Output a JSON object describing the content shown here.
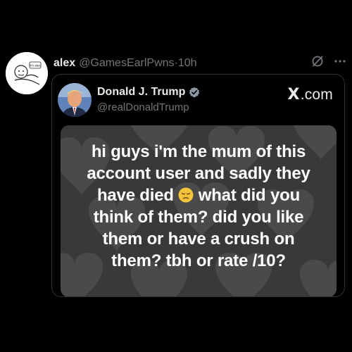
{
  "tweet": {
    "author_name": "alex",
    "author_handle": "@GamesEarlPwns",
    "separator": "·",
    "time": "10h",
    "avatar_text": "i'm alex"
  },
  "quote": {
    "author_name": "Donald J. Trump",
    "author_handle": "@realDonaldTrump",
    "verified_color": "#8b98a5",
    "source_label": ".com",
    "source_mark": "X",
    "text_lines": [
      "hi guys i'm the mum of this",
      "account user and sadly they",
      "have died",
      "what did you",
      "think of them? did you like",
      "them or have a crush on",
      "them? tbh or rate /10?"
    ],
    "emoji": "disappointed-face"
  },
  "icons": {
    "grok": "grok-icon",
    "more": "more-icon",
    "verified": "verified-badge-icon"
  },
  "colors": {
    "background": "#000000",
    "secondary_text": "#71767b",
    "border": "#2f3336",
    "media_bg": "#3a3a3a"
  }
}
